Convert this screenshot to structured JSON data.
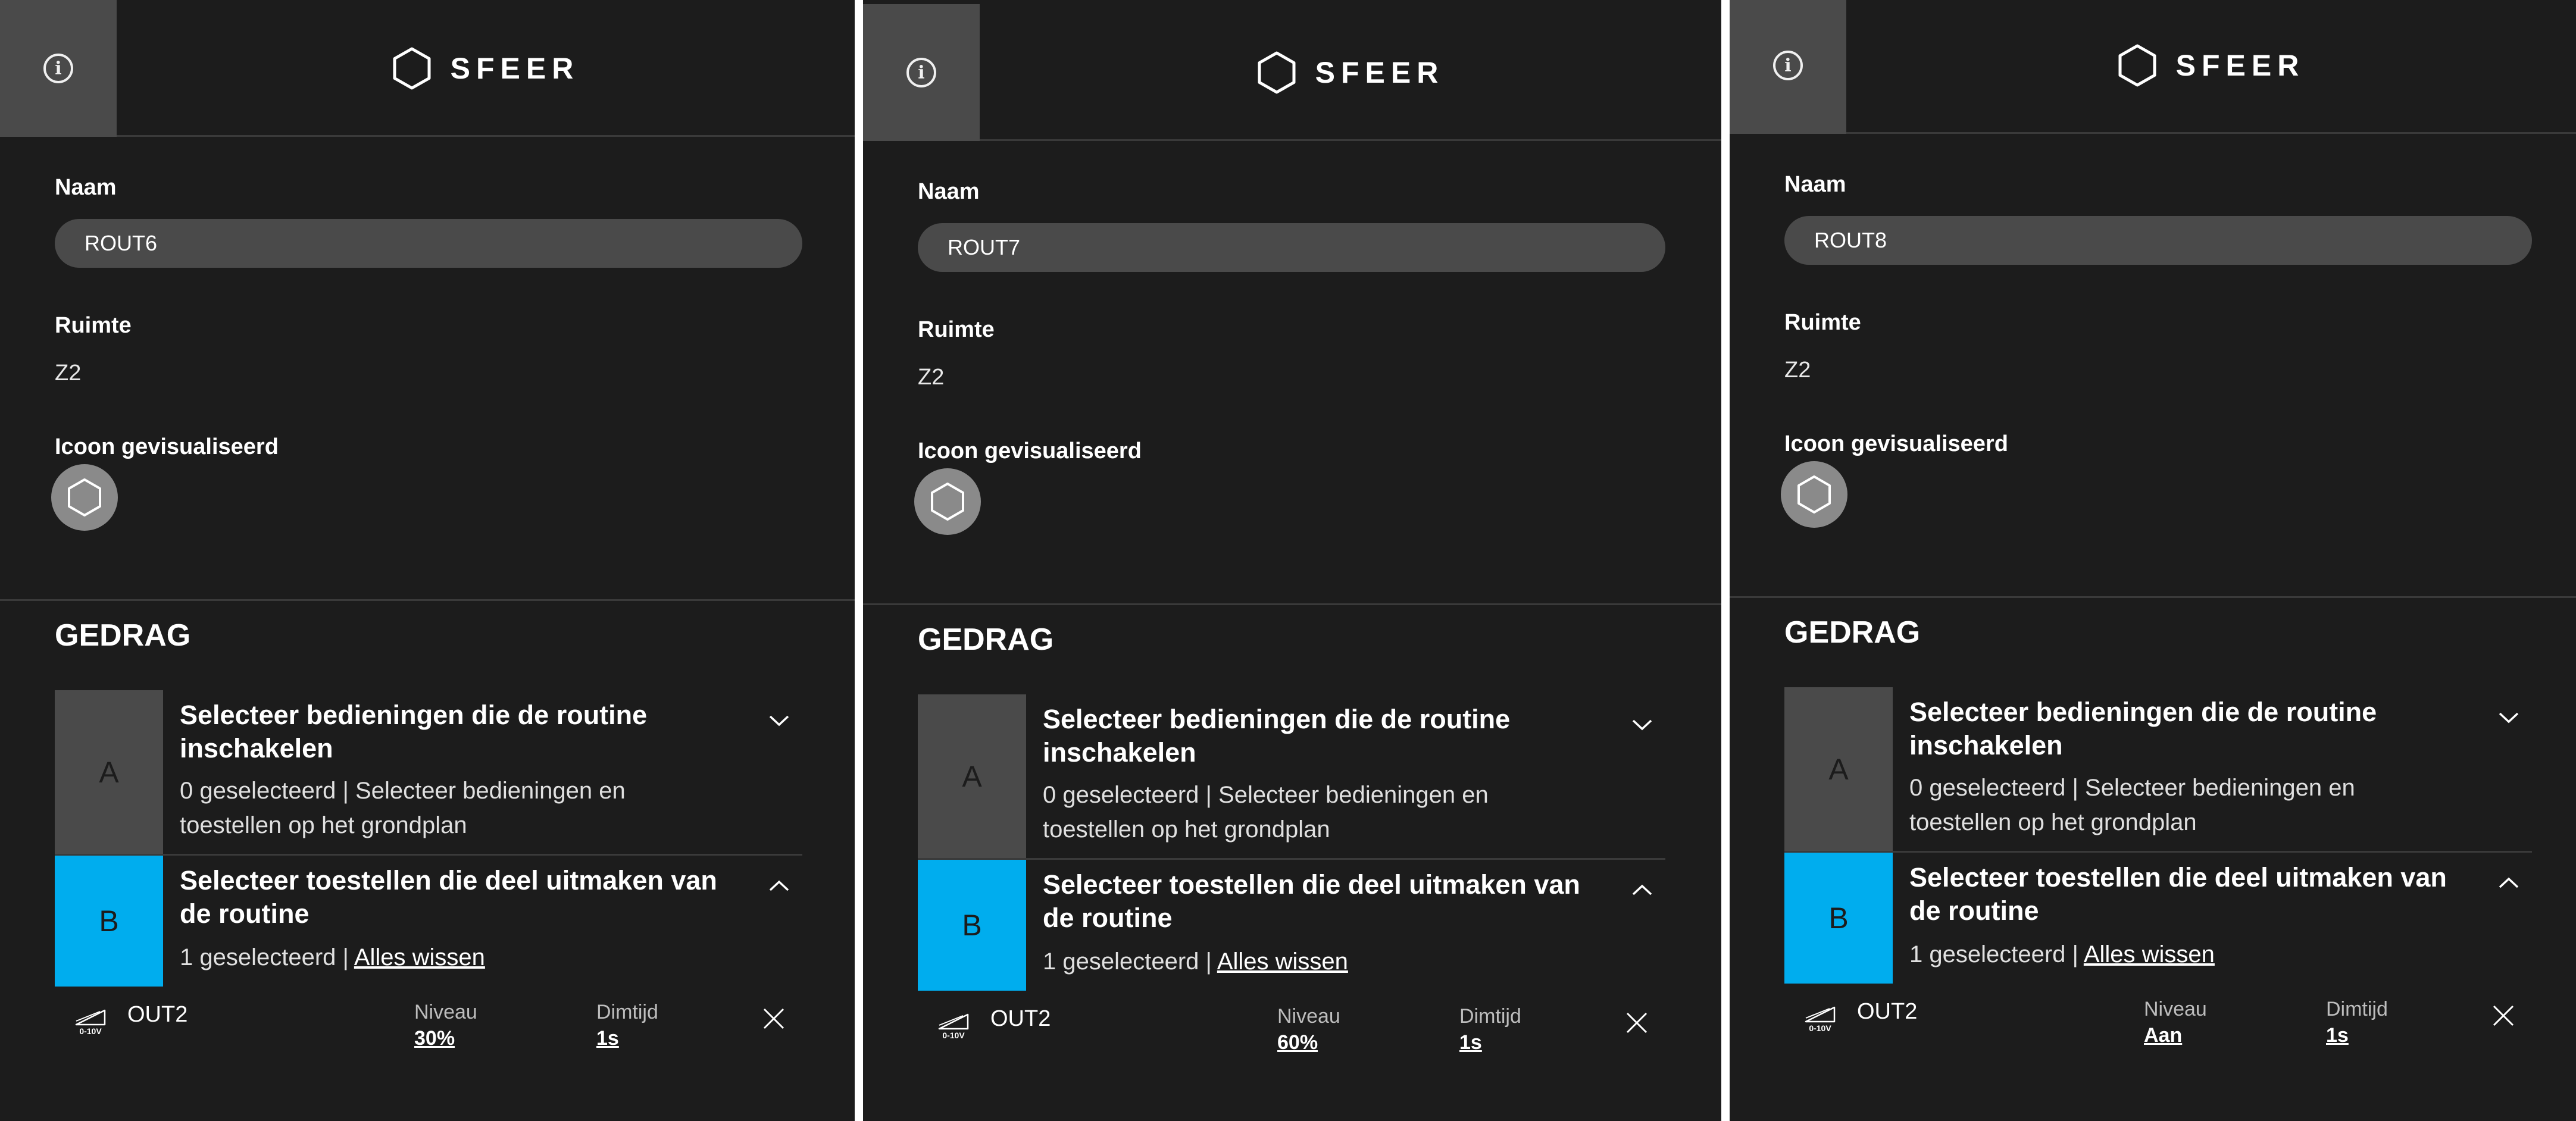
{
  "header": {
    "brand": "SFEER"
  },
  "labels": {
    "name": "Naam",
    "room": "Ruimte",
    "icon": "Icoon gevisualiseerd",
    "section": "GEDRAG",
    "step_a_letter": "A",
    "step_a_title": "Selecteer bedieningen die de routine inschakelen",
    "step_a_count": "0 geselecteerd",
    "step_a_hint": "Selecteer bedieningen en toestellen op het grondplan",
    "step_b_letter": "B",
    "step_b_title": "Selecteer toestellen die deel uitmaken van de routine",
    "step_b_count": "1 geselecteerd",
    "clear_all": "Alles wissen",
    "level": "Niveau",
    "dim_time": "Dimtijd",
    "dev_icon_text": "0-10V"
  },
  "panels": [
    {
      "name": "ROUT6",
      "room": "Z2",
      "device": "OUT2",
      "level": "30%",
      "dim_time": "1s"
    },
    {
      "name": "ROUT7",
      "room": "Z2",
      "device": "OUT2",
      "level": "60%",
      "dim_time": "1s"
    },
    {
      "name": "ROUT8",
      "room": "Z2",
      "device": "OUT2",
      "level": "Aan",
      "dim_time": "1s"
    }
  ],
  "icons": {
    "info": "info-icon",
    "brand": "hexagon-icon",
    "routine": "hexagon-icon",
    "chevron_a": "chevron-down-icon",
    "chevron_b": "chevron-up-icon",
    "device": "dimmer-0-10v-icon",
    "remove": "close-icon"
  },
  "colors": {
    "background": "#1c1c1c",
    "panel_gray": "#4a4a4a",
    "accent_blue": "#00adee",
    "icon_circle": "#8a8a8a"
  }
}
